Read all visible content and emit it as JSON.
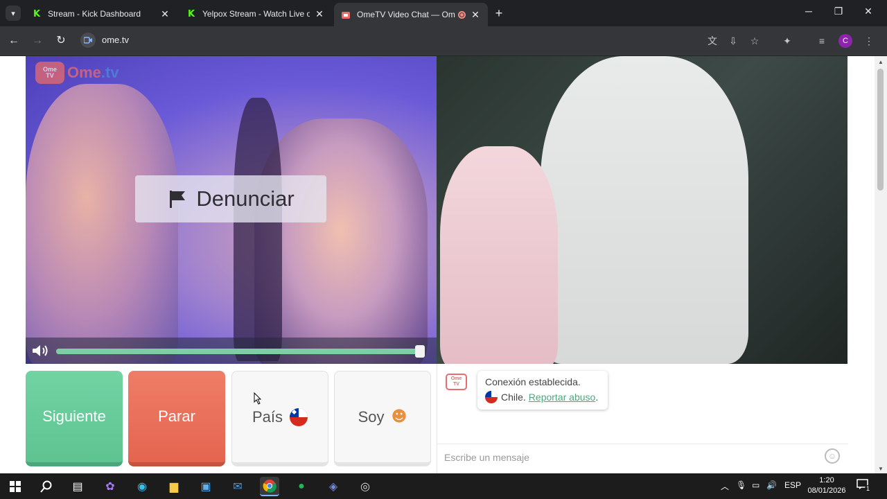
{
  "browser": {
    "tabs": [
      {
        "title": "Stream - Kick Dashboard",
        "favicon": "kick-icon",
        "active": false
      },
      {
        "title": "Yelpox Stream - Watch Live on Kick",
        "favicon": "kick-icon",
        "active": false
      },
      {
        "title": "OmeTV Video Chat — Omegle",
        "favicon": "ometv-icon",
        "active": true,
        "recording": true
      }
    ],
    "url": "ome.tv",
    "profile_initial": "C"
  },
  "page": {
    "logo": {
      "badge_line1": "Ome",
      "badge_line2": "TV",
      "text_a": "Ome",
      "text_b": ".tv"
    },
    "report_button": "Denunciar",
    "volume_level": 0.99,
    "buttons": {
      "next": "Siguiente",
      "stop": "Parar",
      "country": "País",
      "me": "Soy"
    },
    "chat": {
      "logo_line1": "Ome",
      "logo_line2": "TV",
      "status": "Conexión establecida.",
      "country": "Chile.",
      "report_link": "Reportar abuso",
      "report_suffix": ".",
      "input_placeholder": "Escribe un mensaje"
    }
  },
  "taskbar": {
    "language": "ESP",
    "time": "1:20",
    "date": "08/01/2026",
    "notifications": "1"
  },
  "colors": {
    "next": "#5ec391",
    "stop": "#e4654f",
    "link": "#4aa87c",
    "brand_red": "#e96b6b"
  }
}
